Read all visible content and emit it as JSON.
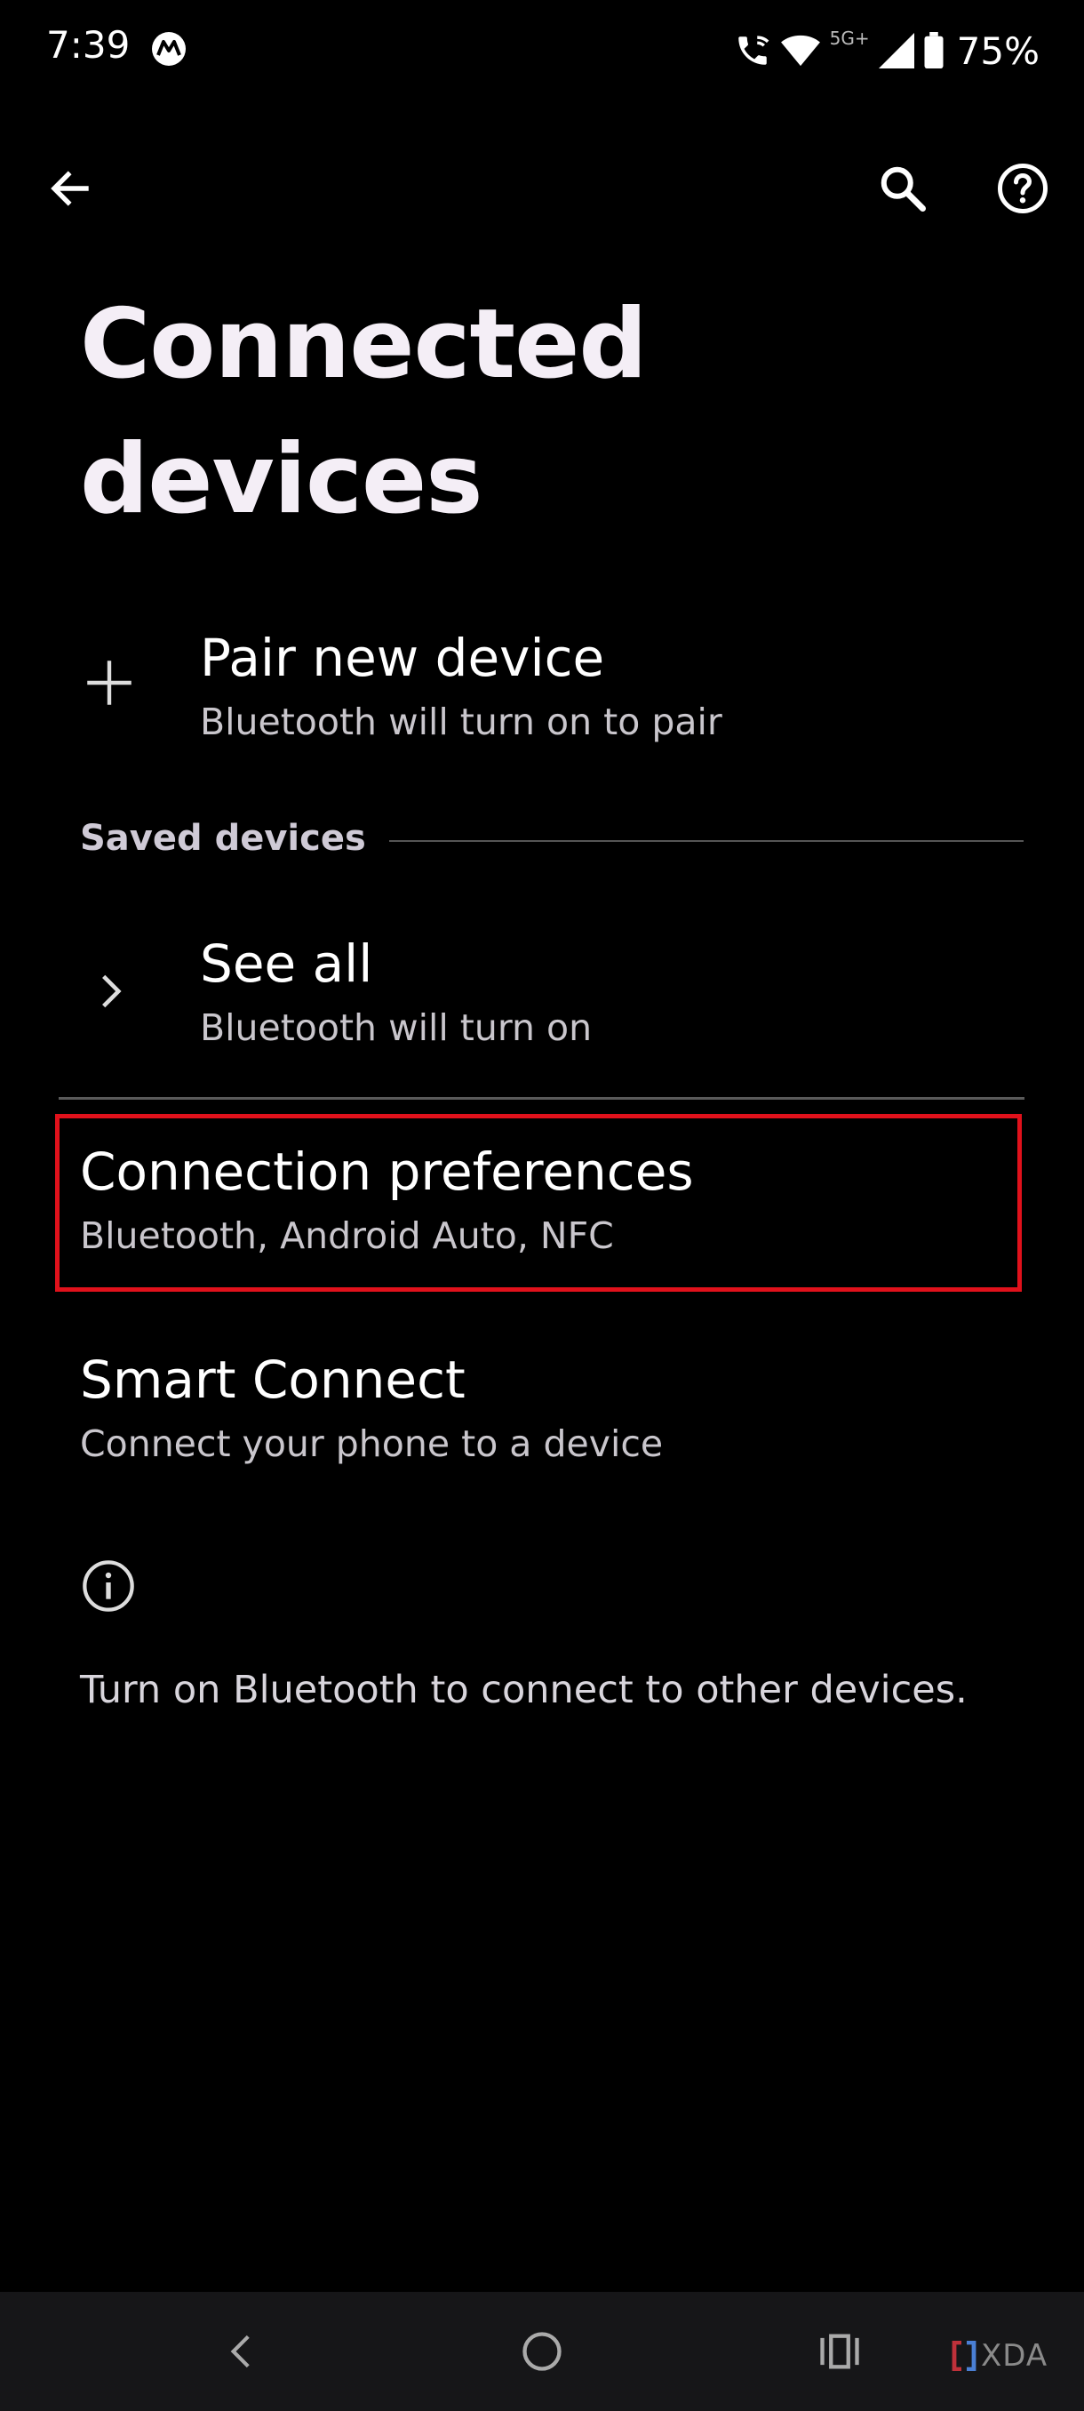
{
  "status_bar": {
    "time": "7:39",
    "network_type": "5G+",
    "battery": "75%",
    "icons": [
      "motorola-icon",
      "wifi-calling-icon",
      "wifi-icon",
      "cell-signal-icon",
      "battery-icon"
    ]
  },
  "app_bar": {
    "icons": [
      "back-arrow-icon",
      "search-icon",
      "help-icon"
    ]
  },
  "page": {
    "title": "Connected devices"
  },
  "pair_new": {
    "title": "Pair new device",
    "subtitle": "Bluetooth will turn on to pair",
    "icon": "plus-icon"
  },
  "saved_devices": {
    "section_label": "Saved devices",
    "see_all": {
      "title": "See all",
      "subtitle": "Bluetooth will turn on",
      "icon": "chevron-right-icon"
    }
  },
  "connection_preferences": {
    "title": "Connection preferences",
    "subtitle": "Bluetooth, Android Auto, NFC",
    "highlight_color": "#e0111b"
  },
  "smart_connect": {
    "title": "Smart Connect",
    "subtitle": "Connect your phone to a device"
  },
  "info": {
    "icon": "info-icon",
    "text": "Turn on Bluetooth to connect to other devices."
  },
  "nav_bar": {
    "icons": [
      "nav-back-icon",
      "nav-home-icon",
      "nav-recents-icon"
    ],
    "watermark": "XDA"
  }
}
